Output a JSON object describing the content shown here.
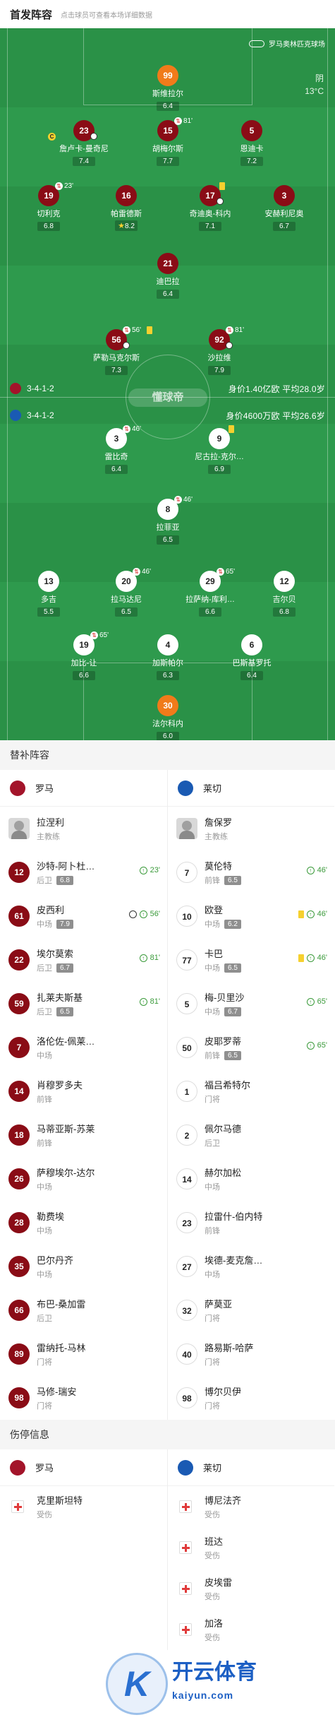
{
  "header": {
    "title": "首发阵容",
    "hint": "点击球员可查看本场详细数据"
  },
  "venue": "罗马奥林匹克球场",
  "weather": {
    "cond": "阴",
    "temp": "13°C"
  },
  "watermark_mid": "懂球帝",
  "home": {
    "crest": "#a3142a",
    "formation": "3-4-1-2",
    "info": "身价1.40亿欧  平均28.0岁"
  },
  "away": {
    "crest": "#1a5ab3",
    "formation": "3-4-1-2",
    "info": "身价4600万欧  平均26.6岁"
  },
  "home_players": [
    {
      "num": "99",
      "name": "斯维拉尔",
      "rating": "6.4",
      "gk": true
    },
    {
      "num": "23",
      "name": "詹卢卡-曼奇尼",
      "rating": "7.4",
      "cap": true,
      "ball": true
    },
    {
      "num": "15",
      "name": "胡梅尔斯",
      "rating": "7.7",
      "sub": "81'"
    },
    {
      "num": "5",
      "name": "恩迪卡",
      "rating": "7.2"
    },
    {
      "num": "19",
      "name": "切利克",
      "rating": "6.8",
      "sub": "23'"
    },
    {
      "num": "16",
      "name": "帕雷德斯",
      "rating": "8.2",
      "star": true
    },
    {
      "num": "17",
      "name": "奇迪奥-科内",
      "rating": "7.1",
      "yc": true,
      "ball": true
    },
    {
      "num": "3",
      "name": "安赫利尼奥",
      "rating": "6.7"
    },
    {
      "num": "21",
      "name": "迪巴拉",
      "rating": "6.4"
    },
    {
      "num": "56",
      "name": "萨勒马克尔斯",
      "rating": "7.3",
      "sub": "56'",
      "yc": true,
      "ball": true
    },
    {
      "num": "92",
      "name": "沙拉维",
      "rating": "7.9",
      "sub": "81'",
      "ball": true
    }
  ],
  "away_players": [
    {
      "num": "3",
      "name": "雷比奇",
      "rating": "6.4",
      "sub": "46'"
    },
    {
      "num": "9",
      "name": "尼古拉-克尔…",
      "rating": "6.9",
      "yc": true
    },
    {
      "num": "8",
      "name": "拉菲亚",
      "rating": "6.5",
      "sub": "46'"
    },
    {
      "num": "13",
      "name": "多吉",
      "rating": "5.5"
    },
    {
      "num": "20",
      "name": "拉马达尼",
      "rating": "6.5",
      "sub": "46'"
    },
    {
      "num": "29",
      "name": "拉萨纳-库利…",
      "rating": "6.6",
      "sub": "65'"
    },
    {
      "num": "12",
      "name": "吉尔贝",
      "rating": "6.8"
    },
    {
      "num": "19",
      "name": "加比-让",
      "rating": "6.6",
      "sub": "65'"
    },
    {
      "num": "4",
      "name": "加斯帕尔",
      "rating": "6.3"
    },
    {
      "num": "6",
      "name": "巴斯基罗托",
      "rating": "6.4"
    },
    {
      "num": "30",
      "name": "法尔科内",
      "rating": "6.0",
      "gk": true
    }
  ],
  "bench": {
    "title": "替补阵容",
    "home_team": "罗马",
    "away_team": "莱切",
    "home": [
      {
        "coach": true,
        "name": "拉涅利",
        "pos": "主教练"
      },
      {
        "num": "12",
        "name": "沙特-阿卜杜…",
        "pos": "后卫",
        "rating": "6.8",
        "ev": "23'",
        "up": true
      },
      {
        "num": "61",
        "name": "皮西利",
        "pos": "中场",
        "rating": "7.9",
        "ev": "56'",
        "up": true,
        "goal": true
      },
      {
        "num": "22",
        "name": "埃尔莫索",
        "pos": "后卫",
        "rating": "6.7",
        "ev": "81'",
        "up": true
      },
      {
        "num": "59",
        "name": "扎莱夫斯基",
        "pos": "后卫",
        "rating": "6.5",
        "ev": "81'",
        "up": true
      },
      {
        "num": "7",
        "name": "洛伦佐-佩莱…",
        "pos": "中场"
      },
      {
        "num": "14",
        "name": "肖穆罗多夫",
        "pos": "前锋"
      },
      {
        "num": "18",
        "name": "马蒂亚斯-苏莱",
        "pos": "前锋"
      },
      {
        "num": "26",
        "name": "萨穆埃尔-达尔",
        "pos": "中场"
      },
      {
        "num": "28",
        "name": "勒费埃",
        "pos": "中场"
      },
      {
        "num": "35",
        "name": "巴尔丹齐",
        "pos": "中场"
      },
      {
        "num": "66",
        "name": "布巴-桑加雷",
        "pos": "后卫"
      },
      {
        "num": "89",
        "name": "雷纳托-马林",
        "pos": "门将"
      },
      {
        "num": "98",
        "name": "马修-瑞安",
        "pos": "门将"
      }
    ],
    "away": [
      {
        "coach": true,
        "name": "詹保罗",
        "pos": "主教练"
      },
      {
        "num": "7",
        "name": "莫伦特",
        "pos": "前锋",
        "rating": "6.5",
        "ev": "46'",
        "up": true
      },
      {
        "num": "10",
        "name": "欧登",
        "pos": "中场",
        "rating": "6.2",
        "ev": "46'",
        "up": true,
        "yellow": true
      },
      {
        "num": "77",
        "name": "卡巴",
        "pos": "中场",
        "rating": "6.5",
        "ev": "46'",
        "up": true,
        "yellow": true
      },
      {
        "num": "5",
        "name": "梅-贝里沙",
        "pos": "中场",
        "rating": "6.7",
        "ev": "65'",
        "up": true
      },
      {
        "num": "50",
        "name": "皮耶罗蒂",
        "pos": "前锋",
        "rating": "6.5",
        "ev": "65'",
        "up": true
      },
      {
        "num": "1",
        "name": "福吕希特尔",
        "pos": "门将"
      },
      {
        "num": "2",
        "name": "佩尔马德",
        "pos": "后卫"
      },
      {
        "num": "14",
        "name": "赫尔加松",
        "pos": "中场"
      },
      {
        "num": "23",
        "name": "拉雷什-伯内特",
        "pos": "前锋"
      },
      {
        "num": "27",
        "name": "埃德-麦克詹…",
        "pos": "中场"
      },
      {
        "num": "32",
        "name": "萨莫亚",
        "pos": "门将"
      },
      {
        "num": "40",
        "name": "路易斯-哈萨",
        "pos": "门将"
      },
      {
        "num": "98",
        "name": "博尔贝伊",
        "pos": "门将"
      }
    ]
  },
  "injury": {
    "title": "伤停信息",
    "home_team": "罗马",
    "away_team": "莱切",
    "home": [
      {
        "name": "克里斯坦特",
        "status": "受伤"
      }
    ],
    "away": [
      {
        "name": "博尼法齐",
        "status": "受伤"
      },
      {
        "name": "班达",
        "status": "受伤"
      },
      {
        "name": "皮埃雷",
        "status": "受伤"
      },
      {
        "name": "加洛",
        "status": "受伤"
      }
    ]
  },
  "brand": {
    "k": "K",
    "name": "开云体育",
    "url": "kaiyun.com"
  }
}
